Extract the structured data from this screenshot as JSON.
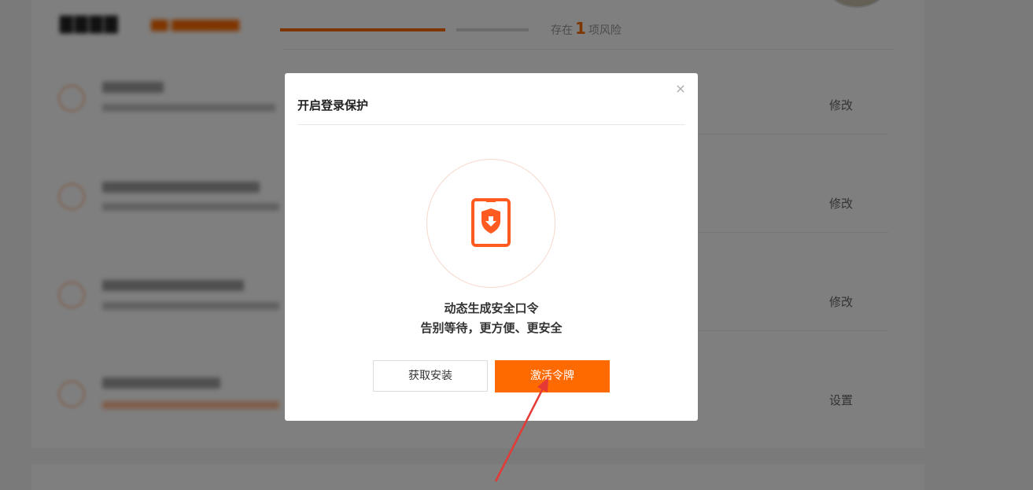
{
  "background": {
    "risk_prefix": "存在",
    "risk_count": "1",
    "risk_suffix": "项风险",
    "rows": [
      {
        "action": "修改"
      },
      {
        "action": "修改"
      },
      {
        "action": "修改"
      },
      {
        "action": "设置"
      }
    ]
  },
  "modal": {
    "title": "开启登录保护",
    "close_glyph": "×",
    "icon": "shield-token-icon",
    "line1": "动态生成安全口令",
    "line2": "告别等待，更方便、更安全",
    "get_button": "获取安装",
    "activate_button": "激活令牌"
  },
  "colors": {
    "accent": "#ff6a00",
    "annotation_arrow": "#e53935"
  }
}
